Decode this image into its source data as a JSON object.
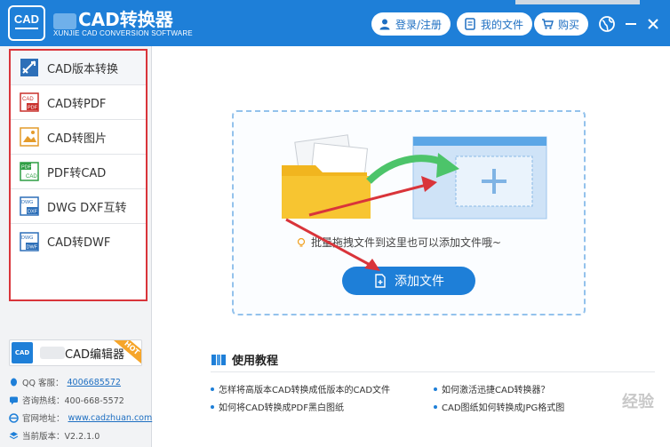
{
  "app": {
    "title": "CAD转换器",
    "subtitle": "XUNJIE CAD CONVERSION SOFTWARE",
    "logo_text": "CAD"
  },
  "titlebar": {
    "login_label": "登录/注册",
    "my_files_label": "我的文件",
    "buy_label": "购买"
  },
  "sidebar": {
    "items": [
      {
        "label": "CAD版本转换",
        "icon": "cad-version-icon",
        "active": true
      },
      {
        "label": "CAD转PDF",
        "icon": "cad-to-pdf-icon",
        "active": false
      },
      {
        "label": "CAD转图片",
        "icon": "cad-to-image-icon",
        "active": false
      },
      {
        "label": "PDF转CAD",
        "icon": "pdf-to-cad-icon",
        "active": false
      },
      {
        "label": "DWG DXF互转",
        "icon": "dwg-dxf-icon",
        "active": false
      },
      {
        "label": "CAD转DWF",
        "icon": "cad-to-dwf-icon",
        "active": false
      }
    ],
    "editor": {
      "label": "CAD编辑器",
      "icon_text": "CAD",
      "tag": "HOT"
    },
    "info": {
      "qq_label": "QQ 客服：",
      "qq_value": "4006685572",
      "hotline": "咨询热线：400-668-5572",
      "website_label": "官网地址：",
      "website_value": "www.cadzhuan.com",
      "version": "当前版本：V2.2.1.0"
    }
  },
  "main": {
    "drop_hint": "拖拽文件到这里也可以添加文件哦~",
    "hint_prefix": "批量",
    "add_button": "添加文件",
    "tutorial": {
      "title": "使用教程",
      "links": [
        "怎样将高版本CAD转换成低版本的CAD文件",
        "如何激活迅捷CAD转换器？",
        "如何将CAD转换成PDF黑白图纸",
        "CAD图纸如何转换成JPG格式图"
      ]
    }
  },
  "colors": {
    "brand_blue": "#1e7fd8",
    "highlight_red": "#d9343a",
    "arrow_green": "#4cc46a",
    "folder_yellow": "#f7c531"
  },
  "watermark": "经验"
}
